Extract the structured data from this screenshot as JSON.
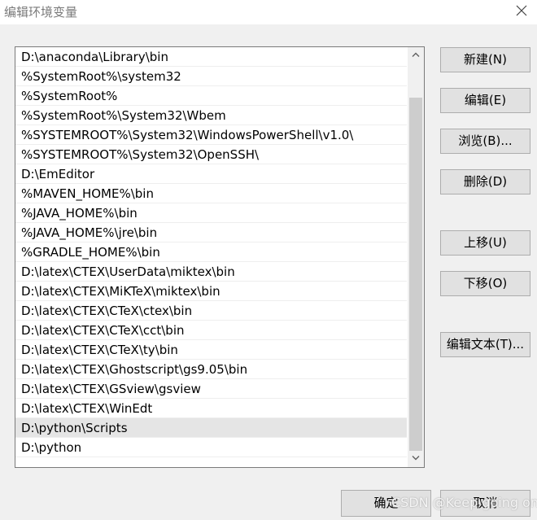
{
  "window": {
    "title": "编辑环境变量"
  },
  "paths": [
    "D:\\anaconda\\Library\\bin",
    "%SystemRoot%\\system32",
    "%SystemRoot%",
    "%SystemRoot%\\System32\\Wbem",
    "%SYSTEMROOT%\\System32\\WindowsPowerShell\\v1.0\\",
    "%SYSTEMROOT%\\System32\\OpenSSH\\",
    "D:\\EmEditor",
    "%MAVEN_HOME%\\bin",
    "%JAVA_HOME%\\bin",
    "%JAVA_HOME%\\jre\\bin",
    "%GRADLE_HOME%\\bin",
    "D:\\latex\\CTEX\\UserData\\miktex\\bin",
    "D:\\latex\\CTEX\\MiKTeX\\miktex\\bin",
    "D:\\latex\\CTEX\\CTeX\\ctex\\bin",
    "D:\\latex\\CTEX\\CTeX\\cct\\bin",
    "D:\\latex\\CTEX\\CTeX\\ty\\bin",
    "D:\\latex\\CTEX\\Ghostscript\\gs9.05\\bin",
    "D:\\latex\\CTEX\\GSview\\gsview",
    "D:\\latex\\CTEX\\WinEdt",
    "D:\\python\\Scripts",
    "D:\\python"
  ],
  "selected_index": 19,
  "buttons": {
    "new": "新建(N)",
    "edit": "编辑(E)",
    "browse": "浏览(B)...",
    "delete": "删除(D)",
    "move_up": "上移(U)",
    "move_down": "下移(O)",
    "edit_text": "编辑文本(T)...",
    "ok": "确定",
    "cancel": "取消"
  },
  "watermark": "CSDN @Keep going on",
  "icons": {
    "close": "close-icon",
    "scroll_up": "chevron-up-icon",
    "scroll_down": "chevron-down-icon"
  },
  "colors": {
    "background": "#f0f0f0",
    "selected_row": "#e5e5e5",
    "button": "#e1e1e1"
  }
}
